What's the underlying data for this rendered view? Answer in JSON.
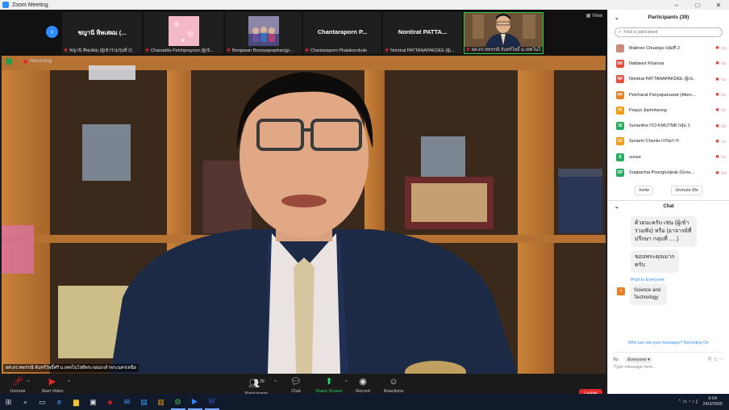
{
  "window": {
    "title": "Zoom Meeting",
    "controls": [
      "–",
      "□",
      "✕"
    ]
  },
  "gallery": {
    "view_label": "View",
    "tiles": [
      {
        "name": "ชญานี หิพเสผม (...",
        "caption": "ชญานี หิพเสผม (ผู้เข้าร่วมรุ่นที่ 2)",
        "has_video": false
      },
      {
        "name": "",
        "caption": "Chanadda Petchprayoon (ผู้เข้...",
        "has_video": true
      },
      {
        "name": "",
        "caption": "Benjawan Boonyapraphan(gr...",
        "has_video": true
      },
      {
        "name": "Chantaraporn P...",
        "caption": "Chantaraporn Phalakornkule",
        "has_video": false
      },
      {
        "name": "Nontirat PATTA...",
        "caption": "Nontirat PATTANAPAKDEE (ผู้เ...",
        "has_video": false
      },
      {
        "name": "",
        "caption": "ผศ.ดร.ทพรรณี จันทร์โพธิ์ ม.เทคโนโลยี...",
        "has_video": true
      }
    ]
  },
  "stage": {
    "recording_label": "Recording",
    "speaker_caption": "ผศ.ดร.ทพรรณี จันทร์โพธิ์ศรี ม.เทคโนโลยีพระจอมเกล้าพระนครเหนือ"
  },
  "toolbar": {
    "unmute": "Unmute",
    "start_video": "Start Video",
    "participants": "Participants",
    "participants_count": "39",
    "chat": "Chat",
    "share_screen": "Share Screen",
    "record": "Record",
    "reactions": "Reactions",
    "leave": "Leave"
  },
  "participants_panel": {
    "title": "Participants (39)",
    "search_placeholder": "Find a participant",
    "items": [
      {
        "initials": "",
        "name": "Matinee Chuanjai กลุ่มที่ 2",
        "color": "#c0392b"
      },
      {
        "initials": "NK",
        "name": "Nattawut Khansai",
        "color": "#e74c3c"
      },
      {
        "initials": "NP",
        "name": "Nontirat PATTANAPAKDEE (ผู้เข...",
        "color": "#e74c3c"
      },
      {
        "initials": "PP",
        "name": "Petcharat Panyapanuwat (Atten...",
        "color": "#e67e22"
      },
      {
        "initials": "PI",
        "name": "Prayut Jiamritwong",
        "color": "#f39c12"
      },
      {
        "initials": "SI",
        "name": "Sunantha ITO-KMUTNB กลุ่ม 1",
        "color": "#27ae60"
      },
      {
        "initials": "SC",
        "name": "Sunarin Chanta กรรมการ",
        "color": "#f39c12"
      },
      {
        "initials": "S",
        "name": "sunee",
        "color": "#27ae60"
      },
      {
        "initials": "SP",
        "name": "Suppachai Pounglunjeak (Grou...",
        "color": "#27ae60"
      }
    ],
    "invite": "Invite",
    "unmute_me": "Unmute Me"
  },
  "chat_panel": {
    "title": "Chat",
    "message_1": "ด้วยนะครับ เช่น (ผู้เข้าร่วมฟัง) หรือ (อาจารย์ที่ปรึกษา กลุ่มที่ .....)",
    "message_2": "ขอบพระคุณมากครับ",
    "from_line": "iPad to Everyone",
    "sender_initial": "I",
    "message_3": "Science and Technology",
    "who_can_see": "Who can see your messages? Recording On",
    "to_label": "To:",
    "to_value": "Everyone ▾",
    "placeholder": "Type message here..."
  },
  "taskbar": {
    "clock_time": "9:04",
    "clock_date": "24/3/2565"
  }
}
